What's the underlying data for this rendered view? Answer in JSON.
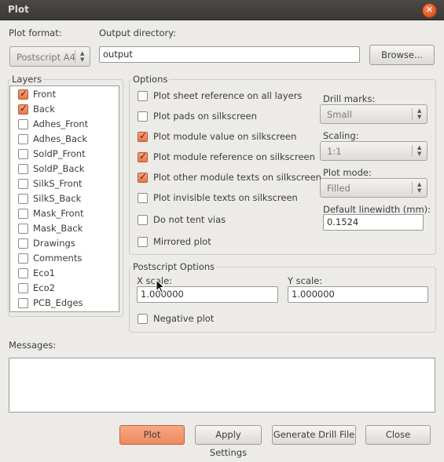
{
  "window": {
    "title": "Plot"
  },
  "plot_format": {
    "label": "Plot format:",
    "value": "Postscript A4"
  },
  "output_dir": {
    "label": "Output directory:",
    "value": "output",
    "browse": "Browse..."
  },
  "layers": {
    "title": "Layers",
    "items": [
      {
        "label": "Front",
        "checked": true
      },
      {
        "label": "Back",
        "checked": true
      },
      {
        "label": "Adhes_Front",
        "checked": false
      },
      {
        "label": "Adhes_Back",
        "checked": false
      },
      {
        "label": "SoldP_Front",
        "checked": false
      },
      {
        "label": "SoldP_Back",
        "checked": false
      },
      {
        "label": "SilkS_Front",
        "checked": false
      },
      {
        "label": "SilkS_Back",
        "checked": false
      },
      {
        "label": "Mask_Front",
        "checked": false
      },
      {
        "label": "Mask_Back",
        "checked": false
      },
      {
        "label": "Drawings",
        "checked": false
      },
      {
        "label": "Comments",
        "checked": false
      },
      {
        "label": "Eco1",
        "checked": false
      },
      {
        "label": "Eco2",
        "checked": false
      },
      {
        "label": "PCB_Edges",
        "checked": false
      }
    ]
  },
  "options": {
    "title": "Options",
    "items": [
      {
        "label": "Plot sheet reference on all layers",
        "checked": false
      },
      {
        "label": "Plot pads on silkscreen",
        "checked": false
      },
      {
        "label": "Plot module value on silkscreen",
        "checked": true
      },
      {
        "label": "Plot module reference on silkscreen",
        "checked": true
      },
      {
        "label": "Plot other module texts on silkscreen",
        "checked": true
      },
      {
        "label": "Plot invisible texts on silkscreen",
        "checked": false
      },
      {
        "label": "Do not tent vias",
        "checked": false
      },
      {
        "label": "Mirrored plot",
        "checked": false
      }
    ],
    "drill_marks": {
      "label": "Drill marks:",
      "value": "Small"
    },
    "scaling": {
      "label": "Scaling:",
      "value": "1:1"
    },
    "plot_mode": {
      "label": "Plot mode:",
      "value": "Filled"
    },
    "linewidth": {
      "label": "Default linewidth (mm):",
      "value": "0.1524"
    }
  },
  "postscript": {
    "title": "Postscript Options",
    "x_scale": {
      "label": "X scale:",
      "value": "1.000000"
    },
    "y_scale": {
      "label": "Y scale:",
      "value": "1.000000"
    },
    "negative": {
      "label": "Negative plot",
      "checked": false
    }
  },
  "messages": {
    "label": "Messages:",
    "value": ""
  },
  "buttons": {
    "plot": "Plot",
    "apply": "Apply Settings",
    "drill": "Generate Drill File",
    "close": "Close"
  },
  "colors": {
    "accent": "#ee8a60",
    "titlebar": "#3f3e3a",
    "background": "#ecebe8"
  }
}
